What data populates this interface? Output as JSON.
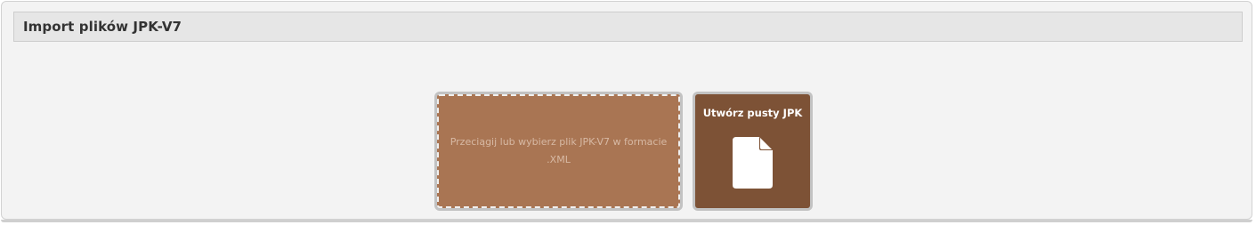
{
  "panel": {
    "title": "Import plików JPK-V7"
  },
  "dropzone": {
    "text": "Przeciągij lub wybierz plik JPK-V7 w formacie .XML"
  },
  "create_empty": {
    "label": "Utwórz pusty JPK",
    "icon": "file-icon"
  },
  "colors": {
    "dropzone_bg": "#a97553",
    "create_bg": "#7d5236",
    "panel_bg": "#f3f3f3",
    "header_bg": "#e6e6e6"
  }
}
